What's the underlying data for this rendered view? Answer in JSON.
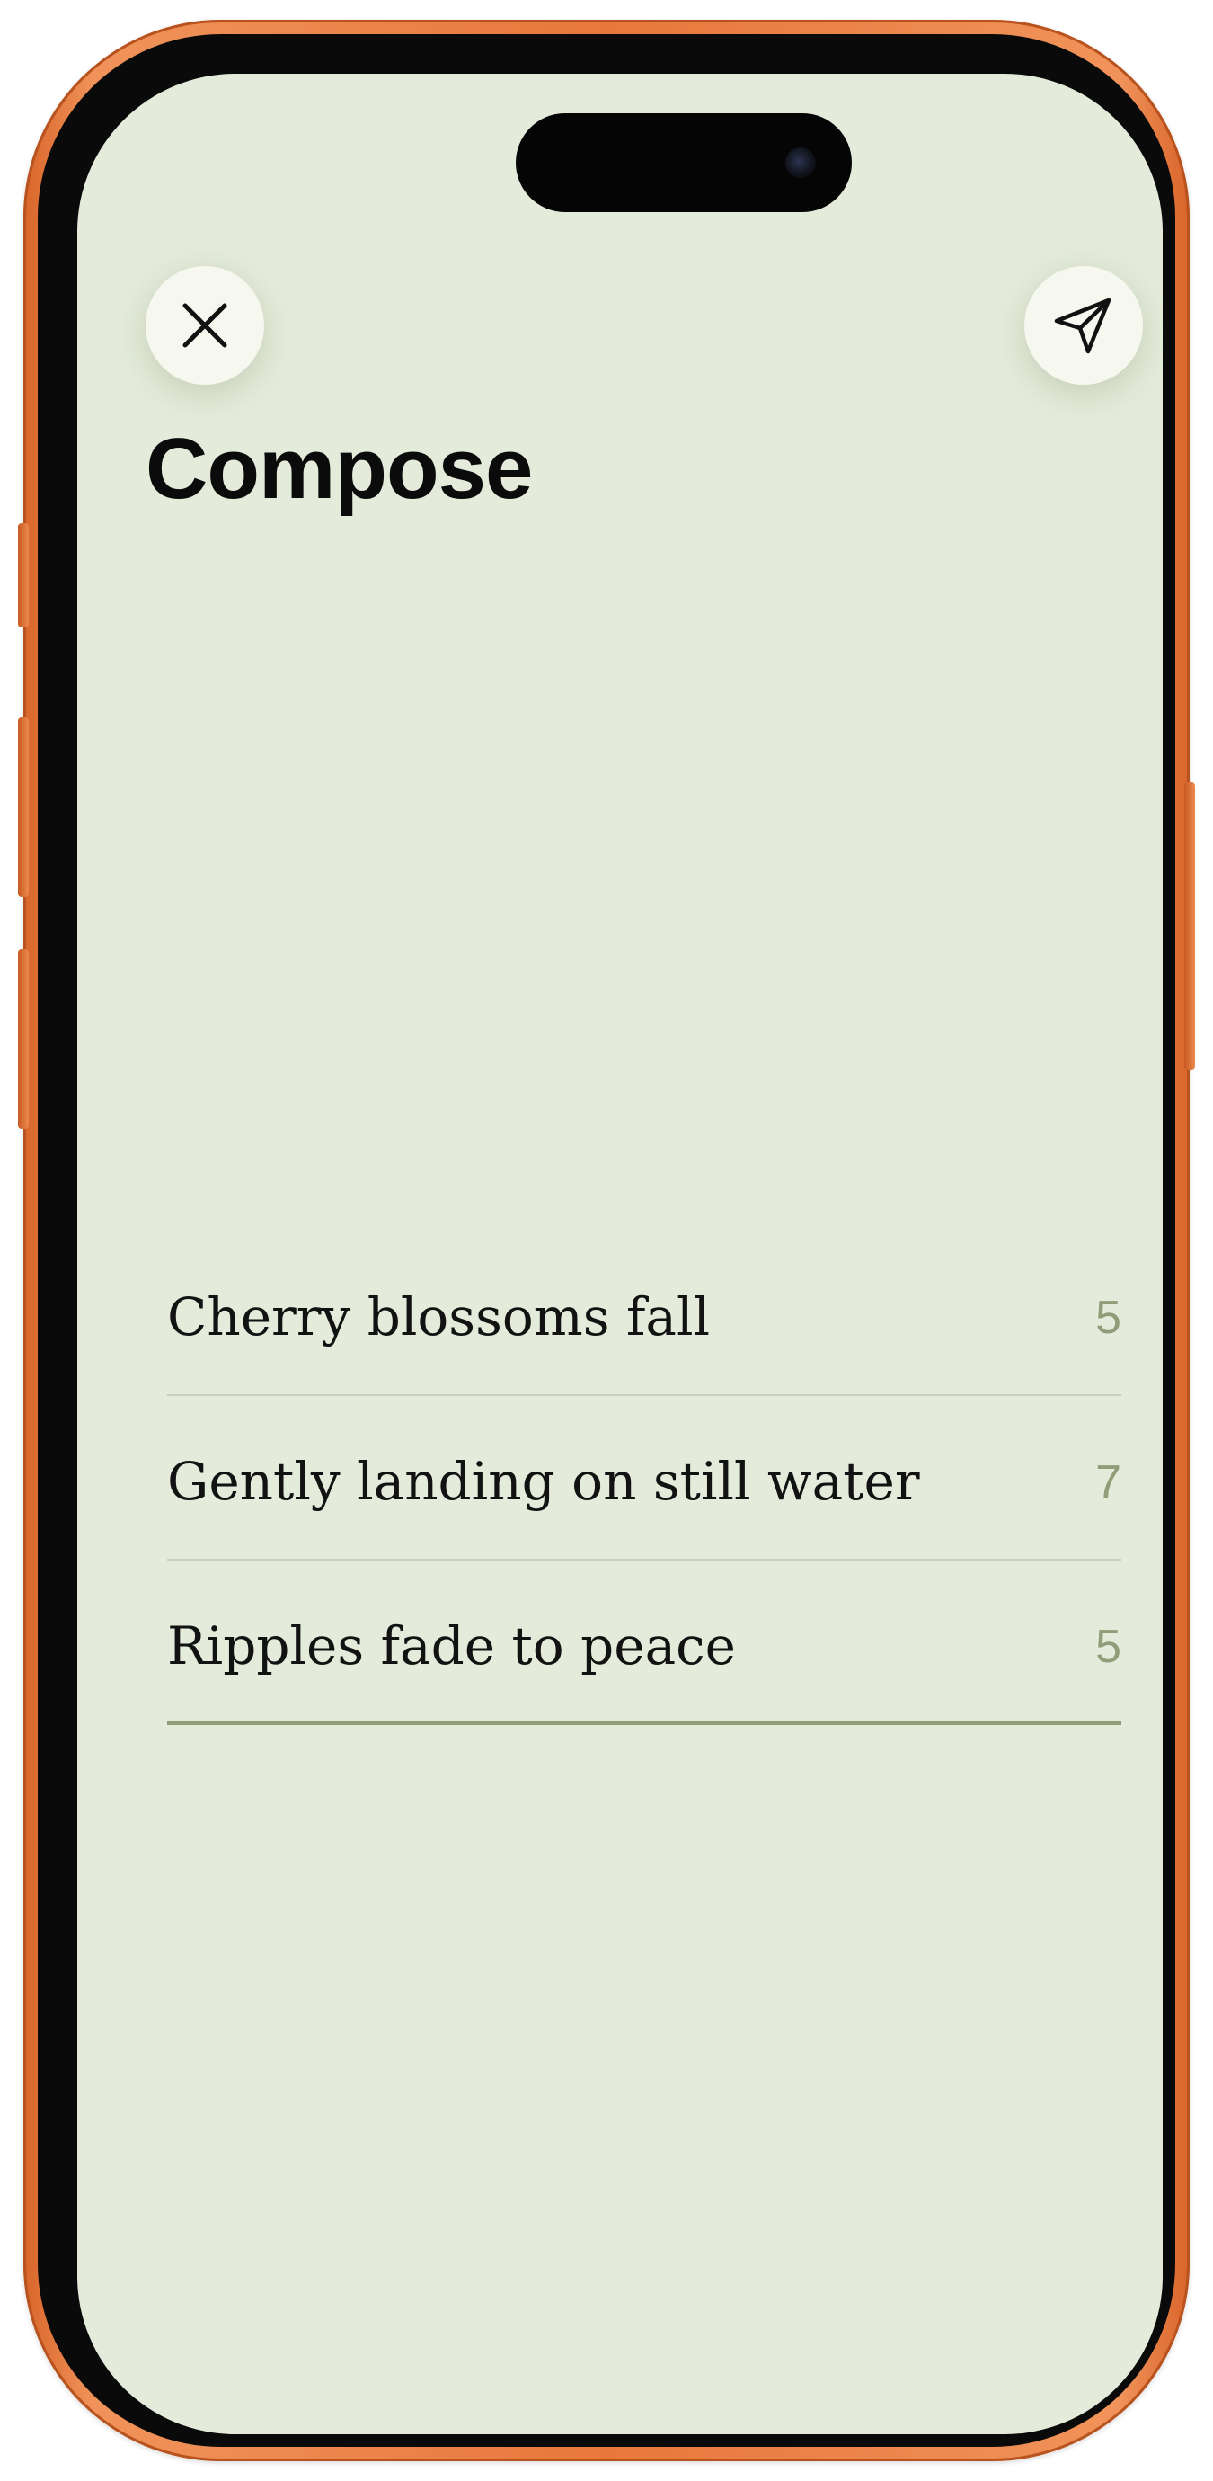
{
  "screen": {
    "title": "Compose",
    "close_icon": "close-icon",
    "send_icon": "send-paper-plane-icon"
  },
  "haiku": {
    "lines": [
      {
        "text": "Cherry blossoms fall",
        "syllables": "5"
      },
      {
        "text": "Gently landing on still water",
        "syllables": "7"
      },
      {
        "text": "Ripples fade to peace",
        "syllables": "5"
      }
    ],
    "active_line": 3
  },
  "colors": {
    "background": "#e4ebda",
    "button_fill": "#f6f8ef",
    "accent": "#8f9d78",
    "divider": "#c9d0bf",
    "device_frame": "#e8773b"
  }
}
